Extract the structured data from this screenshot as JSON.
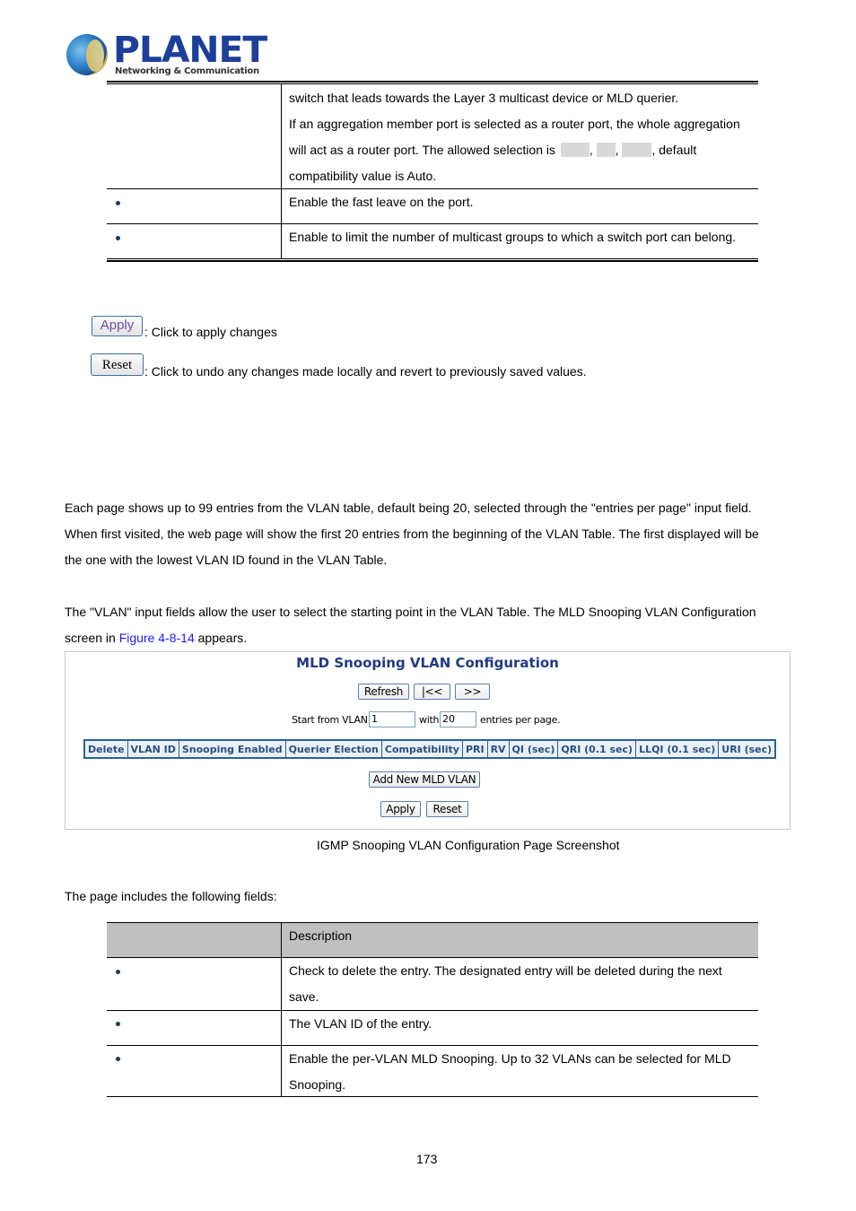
{
  "header": {
    "brand": "PLANET",
    "tagline": "Networking & Communication"
  },
  "top_table": {
    "rows": [
      {
        "label": "",
        "lines": [
          "switch that leads towards the Layer 3 multicast device or MLD querier.",
          "If an aggregation member port is selected as a router port, the whole aggregation",
          "will act as a router port. The allowed selection is",
          ", default",
          "compatibility value is Auto."
        ]
      },
      {
        "label": "",
        "bullet": true,
        "text": "Enable the fast leave on the port."
      },
      {
        "label": "",
        "bullet": true,
        "text": "Enable to limit the number of multicast groups to which a switch port can belong."
      }
    ]
  },
  "buttons_legend": [
    {
      "button_label": "Apply",
      "description": ": Click to apply changes"
    },
    {
      "button_label": "Reset",
      "description": ": Click to undo any changes made locally and revert to previously saved values."
    }
  ],
  "body_paragraphs": {
    "p1": [
      "Each page shows up to 99 entries from the VLAN table, default being 20, selected through the \"entries per page\" input field.",
      "When first visited, the web page will show the first 20 entries from the beginning of the VLAN Table. The first displayed will be",
      "the one with the lowest VLAN ID found in the VLAN Table."
    ],
    "p2_line1": "The \"VLAN\" input fields allow the user to select the starting point in the VLAN Table. The MLD Snooping VLAN Configuration",
    "p2_line2_pre": "screen in ",
    "p2_link": "Figure 4-8-14",
    "p2_line2_post": " appears."
  },
  "screenshot": {
    "title": "MLD Snooping VLAN Configuration",
    "refresh_label": "Refresh",
    "first_label": "|<<",
    "next_label": ">>",
    "start_from_label": "Start from VLAN",
    "start_vlan_value": "1",
    "with_label": "with",
    "entries_value": "20",
    "entries_suffix": "entries per page.",
    "columns": [
      "Delete",
      "VLAN ID",
      "Snooping Enabled",
      "Querier Election",
      "Compatibility",
      "PRI",
      "RV",
      "QI (sec)",
      "QRI (0.1 sec)",
      "LLQI (0.1 sec)",
      "URI (sec)"
    ],
    "add_label": "Add New MLD VLAN",
    "apply_label": "Apply",
    "reset_label": "Reset"
  },
  "caption": "IGMP Snooping VLAN Configuration Page Screenshot",
  "fields_intro": "The page includes the following fields:",
  "fields_table": {
    "header": {
      "object": "",
      "description": "Description"
    },
    "rows": [
      {
        "bullet": true,
        "lines": [
          "Check to delete the entry. The designated entry will be deleted during the next",
          "save."
        ]
      },
      {
        "bullet": true,
        "lines": [
          "The VLAN ID of the entry."
        ]
      },
      {
        "bullet": true,
        "lines": [
          "Enable the per-VLAN MLD Snooping. Up to 32 VLANs can be selected for MLD",
          "Snooping."
        ]
      }
    ]
  },
  "page_number": "173"
}
